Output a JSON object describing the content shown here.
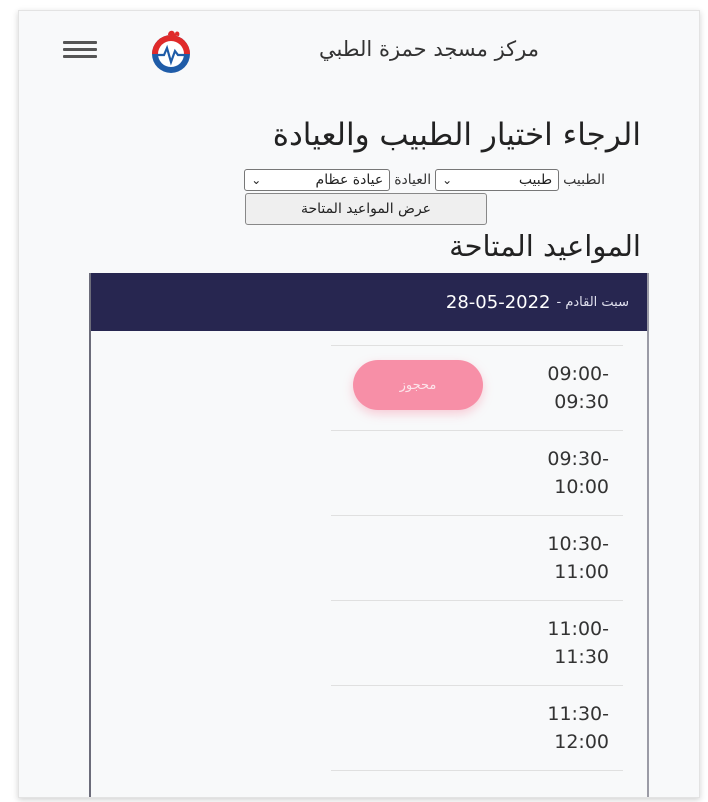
{
  "navbar": {
    "brand": "مركز مسجد حمزة الطبي"
  },
  "page_title": "الرجاء اختيار الطبيب والعيادة",
  "form": {
    "doctor_label": "الطبيب",
    "doctor_value": "طبيب",
    "clinic_label": "العيادة",
    "clinic_value": "عيادة عظام",
    "show_button": "عرض المواعيد المتاحة"
  },
  "section_title": "المواعيد المتاحة",
  "schedule": {
    "day_name": "سبت القادم -",
    "date": "28-05-2022",
    "slots": [
      {
        "start": "09:00-",
        "end": "09:30",
        "status": "محجوز"
      },
      {
        "start": "09:30-",
        "end": "10:00",
        "status": ""
      },
      {
        "start": "10:30-",
        "end": "11:00",
        "status": ""
      },
      {
        "start": "11:00-",
        "end": "11:30",
        "status": ""
      },
      {
        "start": "11:30-",
        "end": "12:00",
        "status": ""
      }
    ]
  },
  "colors": {
    "header_bg": "#272650",
    "booked_badge": "#f78fa7",
    "logo_red": "#e02a2a",
    "logo_blue": "#1f5ca8"
  },
  "icons": {
    "menu": "hamburger-menu-icon",
    "logo": "heart-pulse-logo-icon",
    "dropdown": "chevron-down-icon"
  }
}
